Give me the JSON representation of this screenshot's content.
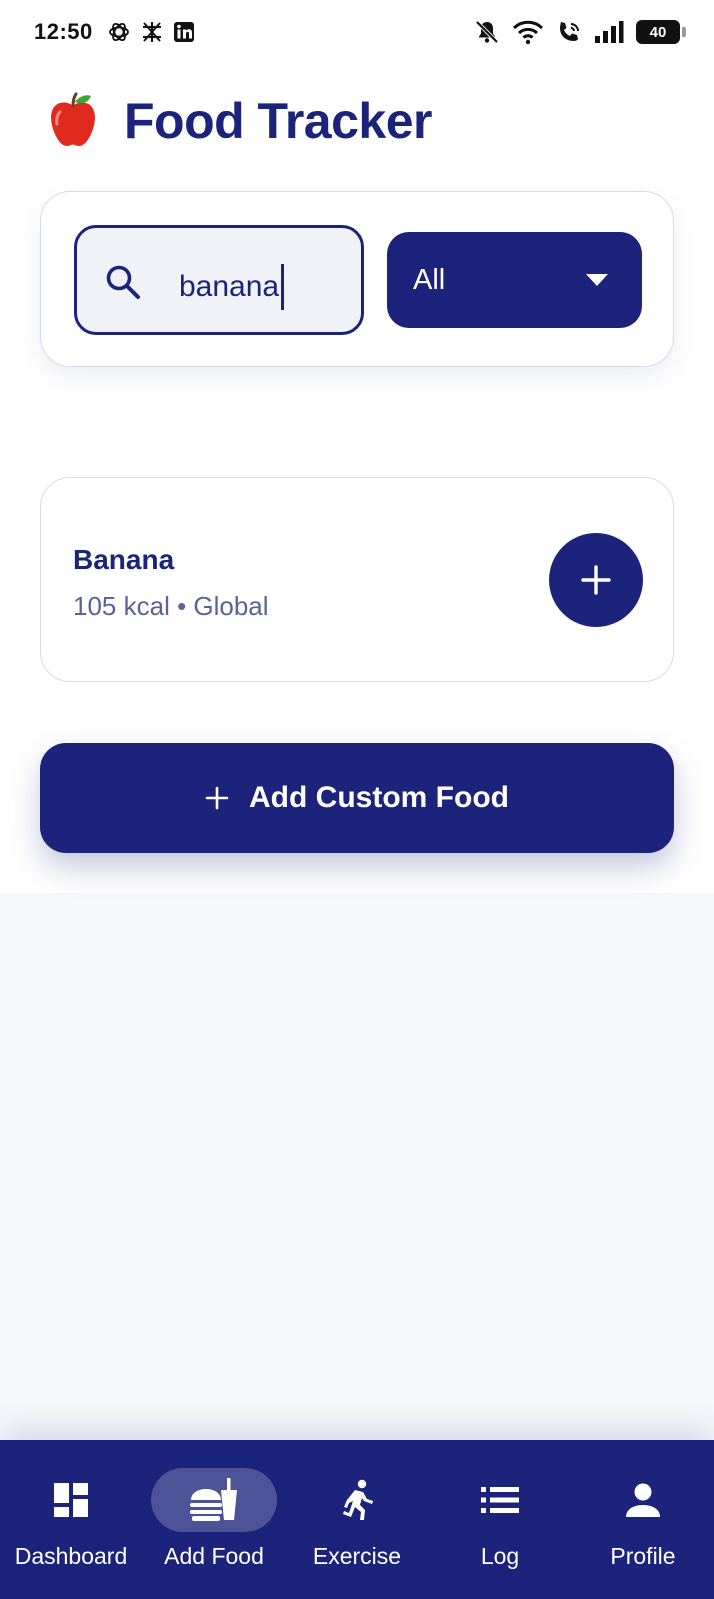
{
  "status_bar": {
    "time": "12:50",
    "battery": "40",
    "left_icons": [
      "openai-icon",
      "perplexity-icon",
      "linkedin-icon"
    ],
    "right_icons": [
      "bell-muted-icon",
      "wifi-icon",
      "wifi-call-icon",
      "signal-icon",
      "battery-icon"
    ]
  },
  "header": {
    "title": "Food Tracker",
    "logo_icon": "apple-icon"
  },
  "search": {
    "value": "banana",
    "icon": "search-icon"
  },
  "filter": {
    "selected": "All",
    "icon": "dropdown-arrow-icon"
  },
  "results": [
    {
      "name": "Banana",
      "meta": "105 kcal • Global"
    }
  ],
  "custom_food_button": {
    "label": "Add Custom Food"
  },
  "nav": {
    "items": [
      {
        "label": "Dashboard",
        "icon": "dashboard-icon",
        "active": false
      },
      {
        "label": "Add Food",
        "icon": "fastfood-icon",
        "active": true
      },
      {
        "label": "Exercise",
        "icon": "running-icon",
        "active": false
      },
      {
        "label": "Log",
        "icon": "list-icon",
        "active": false
      },
      {
        "label": "Profile",
        "icon": "person-icon",
        "active": false
      }
    ]
  },
  "colors": {
    "primary": "#1b237a",
    "background": "#f7f8fb",
    "surface": "#ffffff",
    "muted_text": "#5c6296"
  }
}
